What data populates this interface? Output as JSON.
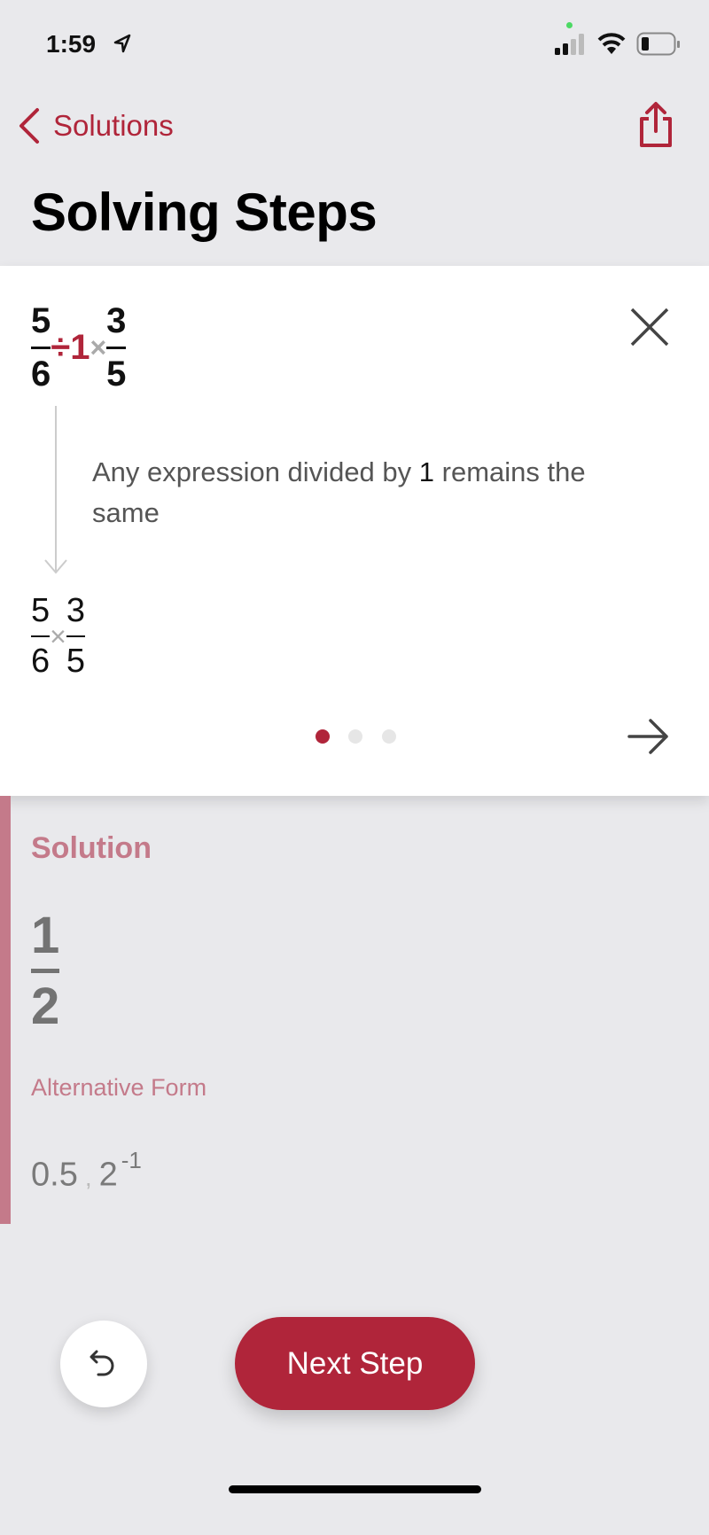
{
  "status_bar": {
    "time": "1:59",
    "icons": [
      "location-arrow-icon",
      "signal-icon",
      "wifi-icon",
      "battery-icon"
    ]
  },
  "nav": {
    "back_label": "Solutions",
    "share_icon": "share-icon"
  },
  "title": "Solving Steps",
  "step": {
    "expression": {
      "f1": {
        "num": "5",
        "den": "6"
      },
      "divide": "÷",
      "one": "1",
      "times": "×",
      "f2": {
        "num": "3",
        "den": "5"
      }
    },
    "explanation": {
      "before": "Any expression divided by ",
      "highlight": "1",
      "after": " remains the same"
    },
    "result": {
      "f1": {
        "num": "5",
        "den": "6"
      },
      "times": "×",
      "f2": {
        "num": "3",
        "den": "5"
      }
    },
    "pager": {
      "total": 3,
      "current": 1
    }
  },
  "solution": {
    "heading": "Solution",
    "num": "1",
    "den": "2",
    "alt_label": "Alternative Form",
    "alt_value1": "0.5",
    "sep": ",",
    "alt_base": "2",
    "alt_exp": "-1"
  },
  "actions": {
    "next_label": "Next Step"
  },
  "colors": {
    "accent": "#b0253a",
    "muted_accent": "#c47a8a",
    "background": "#e9e9ec"
  }
}
